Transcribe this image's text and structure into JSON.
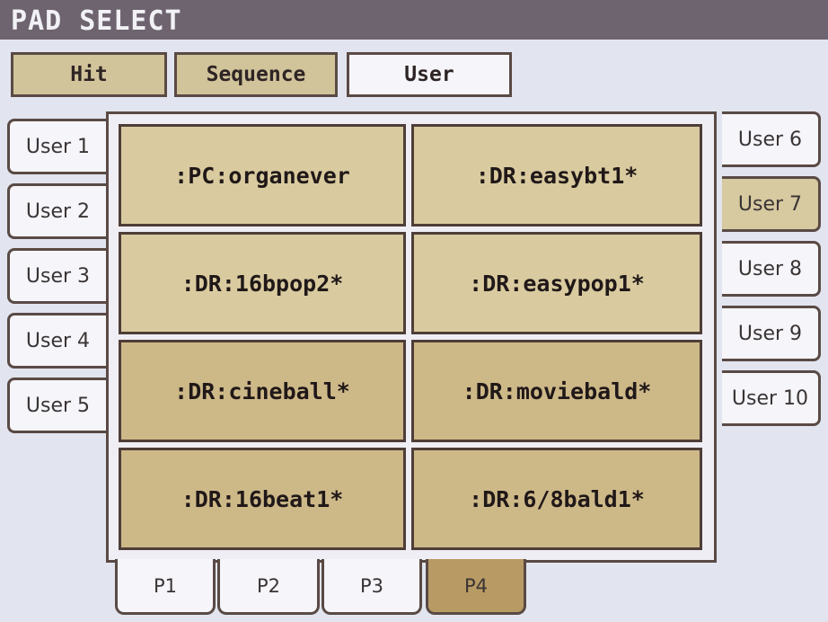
{
  "window": {
    "title": "PAD SELECT"
  },
  "top_tabs": [
    {
      "label": "Hit",
      "active": false
    },
    {
      "label": "Sequence",
      "active": false
    },
    {
      "label": "User",
      "active": true
    }
  ],
  "left_tabs": [
    {
      "label": "User 1"
    },
    {
      "label": "User 2"
    },
    {
      "label": "User 3"
    },
    {
      "label": "User 4"
    },
    {
      "label": "User 5"
    }
  ],
  "right_tabs": [
    {
      "label": "User 6",
      "active": false
    },
    {
      "label": "User 7",
      "active": true
    },
    {
      "label": "User 8",
      "active": false
    },
    {
      "label": "User 9",
      "active": false
    },
    {
      "label": "User 10",
      "active": false
    }
  ],
  "pads": [
    ":PC:organever",
    ":DR:easybt1*",
    ":DR:16bpop2*",
    ":DR:easypop1*",
    ":DR:cineball*",
    ":DR:moviebald*",
    ":DR:16beat1*",
    ":DR:6/8bald1*"
  ],
  "bottom_tabs": [
    {
      "label": "P1",
      "active": false
    },
    {
      "label": "P2",
      "active": false
    },
    {
      "label": "P3",
      "active": false
    },
    {
      "label": "P4",
      "active": true
    }
  ],
  "colors": {
    "title_bar": "#6e6470",
    "pad": "#d9cb9f",
    "active_tab": "#d7c9a0",
    "active_page_tab": "#b89a64"
  }
}
